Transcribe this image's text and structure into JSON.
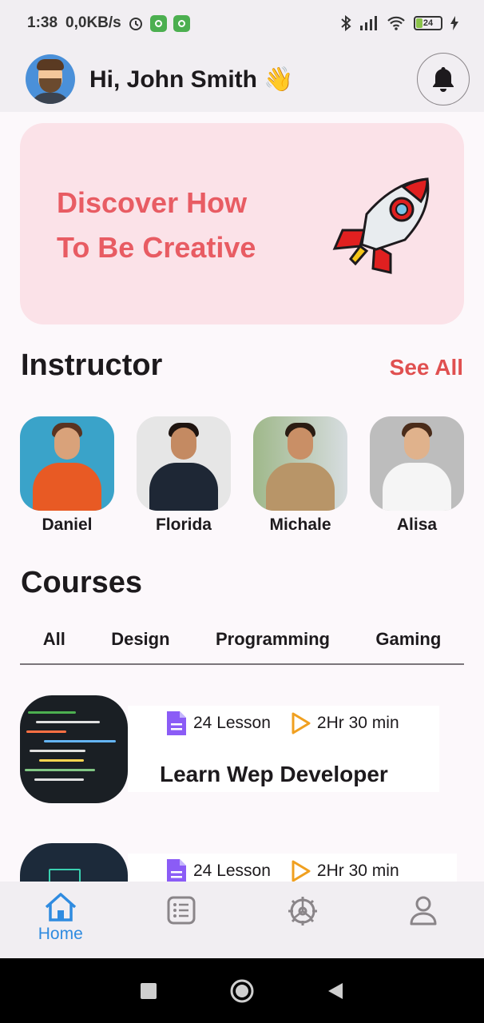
{
  "status_bar": {
    "time": "1:38",
    "network_speed": "0,0KB/s",
    "battery": "24"
  },
  "header": {
    "greeting": "Hi, John Smith",
    "wave_emoji": "👋"
  },
  "banner": {
    "line1": "Discover How",
    "line2": "To Be Creative"
  },
  "instructor_section": {
    "title": "Instructor",
    "see_all": "See All"
  },
  "instructors": [
    {
      "name": "Daniel"
    },
    {
      "name": "Florida"
    },
    {
      "name": "Michale"
    },
    {
      "name": "Alisa"
    }
  ],
  "courses_section": {
    "title": "Courses",
    "tabs": [
      "All",
      "Design",
      "Programming",
      "Gaming"
    ]
  },
  "courses": [
    {
      "lessons": "24 Lesson",
      "duration": "2Hr 30 min",
      "title": "Learn Wep Developer"
    },
    {
      "lessons": "24 Lesson",
      "duration": "2Hr 30 min",
      "title": ""
    }
  ],
  "bottom_nav": {
    "home_label": "Home"
  },
  "colors": {
    "accent": "#2f8be0",
    "banner_text": "#e85c63",
    "see_all": "#e05050",
    "lesson_icon": "#8b5cf6",
    "play_icon": "#f0a020"
  }
}
